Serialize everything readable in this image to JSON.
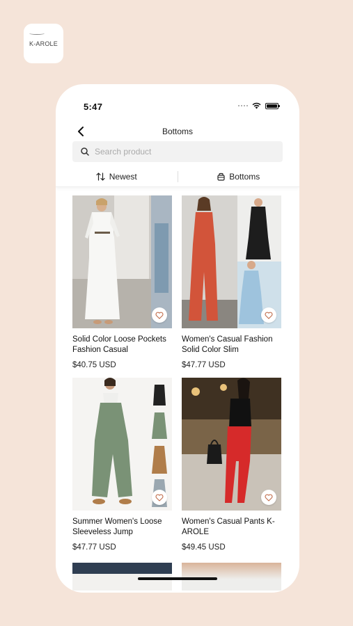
{
  "app_logo": {
    "text": "K-AROLE"
  },
  "status_bar": {
    "time": "5:47"
  },
  "header": {
    "title": "Bottoms",
    "back_icon": "chevron-left-icon"
  },
  "search": {
    "placeholder": "Search product",
    "value": ""
  },
  "filters": [
    {
      "label": "Newest",
      "icon": "sort-arrows-icon"
    },
    {
      "label": "Bottoms",
      "icon": "category-icon"
    }
  ],
  "products": [
    {
      "title": "Solid Color Loose Pockets Fashion Casual",
      "price": "$40.75 USD"
    },
    {
      "title": "Women's Casual Fashion Solid Color Slim",
      "price": "$47.77 USD"
    },
    {
      "title": "Summer Women's Loose Sleeveless Jump",
      "price": "$47.77 USD"
    },
    {
      "title": "Women's Casual Pants K-AROLE",
      "price": "$49.45 USD"
    }
  ],
  "colors": {
    "background": "#f5e4d9",
    "text": "#111111",
    "accent_icon": "#c06c4a"
  }
}
